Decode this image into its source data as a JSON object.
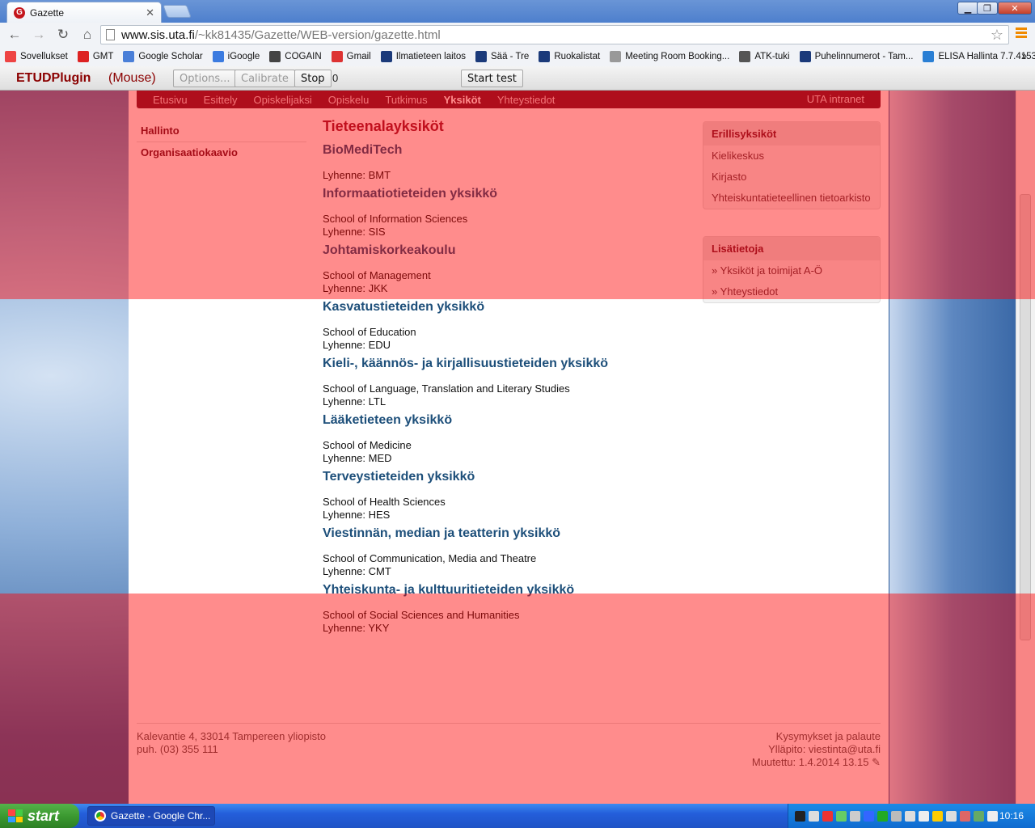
{
  "browser": {
    "tab_title": "Gazette",
    "tab_favicon_letter": "G",
    "url_host": "www.sis.uta.fi",
    "url_path": "/~kk81435/Gazette/WEB-version/gazette.html",
    "bookmarks": [
      {
        "label": "Sovellukset",
        "icon": "apps-grid-icon",
        "color": "#e44"
      },
      {
        "label": "GMT",
        "icon": "gmt-icon",
        "color": "#d22"
      },
      {
        "label": "Google Scholar",
        "icon": "scholar-icon",
        "color": "#4a7fd8"
      },
      {
        "label": "iGoogle",
        "icon": "igoogle-icon",
        "color": "#3b7be0"
      },
      {
        "label": "COGAIN",
        "icon": "cogain-icon",
        "color": "#444"
      },
      {
        "label": "Gmail",
        "icon": "gmail-icon",
        "color": "#d33"
      },
      {
        "label": "Ilmatieteen laitos",
        "icon": "bookmark-flag-icon",
        "color": "#1b3a7a"
      },
      {
        "label": "Sää - Tre",
        "icon": "bookmark-flag-icon",
        "color": "#1b3a7a"
      },
      {
        "label": "Ruokalistat",
        "icon": "bookmark-flag-icon",
        "color": "#1b3a7a"
      },
      {
        "label": "Meeting Room Booking...",
        "icon": "page-icon",
        "color": "#999"
      },
      {
        "label": "ATK-tuki",
        "icon": "atk-icon",
        "color": "#555"
      },
      {
        "label": "Puhelinnumerot - Tam...",
        "icon": "bookmark-flag-icon",
        "color": "#1b3a7a"
      },
      {
        "label": "ELISA Hallinta 7.7.4153",
        "icon": "elisa-icon",
        "color": "#2a7fd4"
      }
    ],
    "bookmarks_more": "»"
  },
  "plugin": {
    "name": "ETUDPlugin",
    "mode": "(Mouse)",
    "options_label": "Options...",
    "calibrate_label": "Calibrate",
    "stop_label": "Stop",
    "count": "0",
    "start_test_label": "Start test"
  },
  "site": {
    "nav": [
      "Etusivu",
      "Esittely",
      "Opiskelijaksi",
      "Opiskelu",
      "Tutkimus",
      "Yksiköt",
      "Yhteystiedot"
    ],
    "nav_active": "Yksiköt",
    "nav_right": "UTA intranet",
    "leftnav": [
      "Hallinto",
      "Organisaatiokaavio"
    ],
    "heading": "Tieteenalayksiköt",
    "units": [
      {
        "name": "BioMediTech",
        "english": "",
        "abbr": "Lyhenne: BMT"
      },
      {
        "name": "Informaatiotieteiden yksikkö",
        "english": "School of Information Sciences",
        "abbr": "Lyhenne: SIS"
      },
      {
        "name": "Johtamiskorkeakoulu",
        "english": "School of Management",
        "abbr": "Lyhenne: JKK"
      },
      {
        "name": "Kasvatustieteiden yksikkö",
        "english": "School of Education",
        "abbr": "Lyhenne: EDU"
      },
      {
        "name": "Kieli-, käännös- ja kirjallisuustieteiden yksikkö",
        "english": "School of Language, Translation and Literary Studies",
        "abbr": "Lyhenne: LTL"
      },
      {
        "name": "Lääketieteen yksikkö",
        "english": "School of Medicine",
        "abbr": "Lyhenne: MED"
      },
      {
        "name": "Terveystieteiden yksikkö",
        "english": "School of Health Sciences",
        "abbr": "Lyhenne: HES"
      },
      {
        "name": "Viestinnän, median ja teatterin yksikkö",
        "english": "School of Communication, Media and Theatre",
        "abbr": "Lyhenne: CMT"
      },
      {
        "name": "Yhteiskunta- ja kulttuuritieteiden yksikkö",
        "english": "School of Social Sciences and Humanities",
        "abbr": "Lyhenne: YKY"
      }
    ],
    "box1": {
      "title": "Erillisyksiköt",
      "items": [
        "Kielikeskus",
        "Kirjasto",
        "Yhteiskuntatieteellinen tietoarkisto"
      ]
    },
    "box2": {
      "title": "Lisätietoja",
      "items": [
        "Yksiköt ja toimijat A-Ö",
        "Yhteystiedot"
      ]
    },
    "footer": {
      "address": "Kalevantie 4, 33014 Tampereen yliopisto",
      "phone": "puh. (03) 355 111",
      "feedback": "Kysymykset ja palaute",
      "maintainer": "Ylläpito: viestinta@uta.fi",
      "modified": "Muutettu: 1.4.2014 13.15"
    }
  },
  "taskbar": {
    "start_label": "start",
    "window_label": "Gazette - Google Chr...",
    "clock": "10:16"
  },
  "colors": {
    "accent_maroon": "#6d1a33",
    "unit_heading_blue": "#1d4f7a",
    "overlay_red": "rgba(255,0,0,0.45)"
  }
}
